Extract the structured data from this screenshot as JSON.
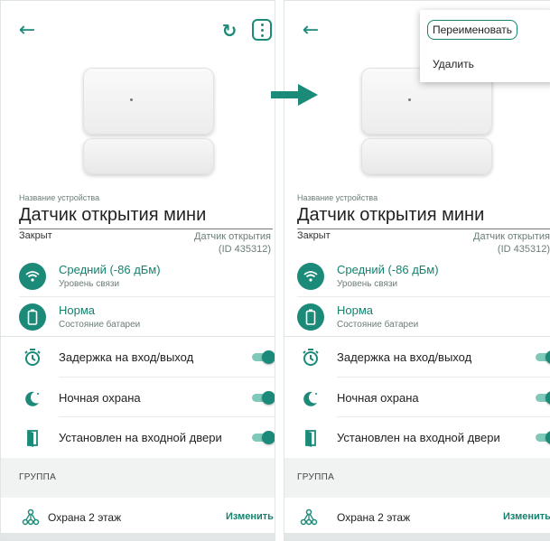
{
  "device": {
    "field_label": "Название устройства",
    "name": "Датчик открытия мини",
    "state": "Закрыт",
    "type_line1": "Датчик открытия",
    "type_line2": "(ID 435312)"
  },
  "signal": {
    "title": "Средний (-86 дБм)",
    "subtitle": "Уровень связи",
    "icon": "wifi-icon"
  },
  "battery": {
    "title": "Норма",
    "subtitle": "Состояние батареи",
    "icon": "battery-icon"
  },
  "options": [
    {
      "label": "Задержка на вход/выход",
      "icon": "timer-icon",
      "enabled": true
    },
    {
      "label": "Ночная охрана",
      "icon": "moon-icon",
      "enabled": true
    },
    {
      "label": "Установлен на входной двери",
      "icon": "door-icon",
      "enabled": true
    }
  ],
  "group": {
    "header": "ГРУППА",
    "name": "Охрана 2 этаж",
    "action": "Изменить",
    "icon": "group-icon"
  },
  "menu": {
    "rename": "Переименовать",
    "delete": "Удалить"
  },
  "colors": {
    "accent": "#1c8a78",
    "accent_light": "#7ec9b9",
    "muted_text": "#6b7d7a"
  }
}
